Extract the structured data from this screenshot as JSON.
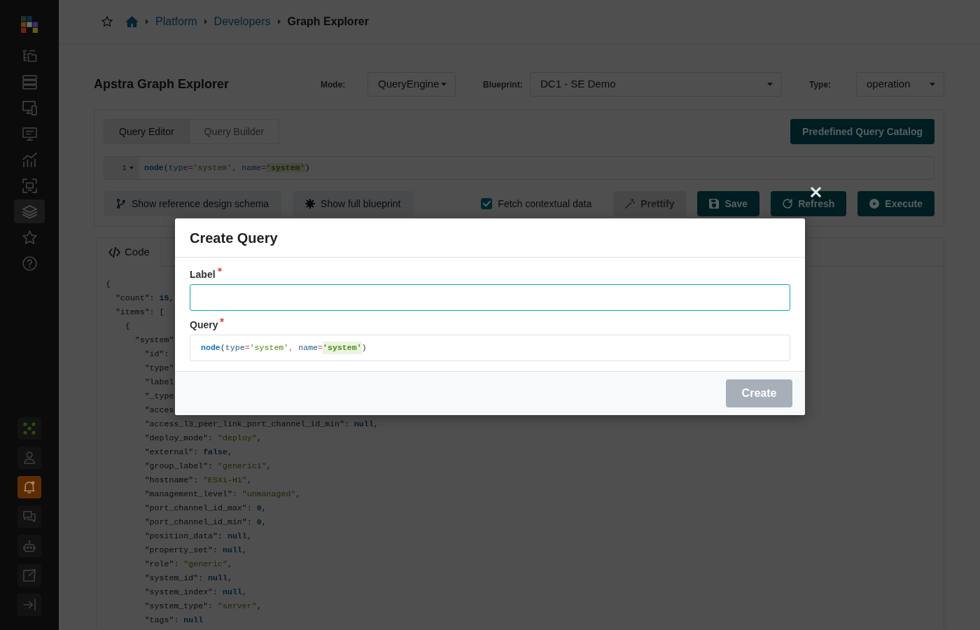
{
  "sidebar": {
    "nav_items": [
      {
        "selected": false
      },
      {
        "selected": false
      },
      {
        "selected": false
      },
      {
        "selected": false
      },
      {
        "selected": false
      },
      {
        "selected": false
      },
      {
        "selected": true
      },
      {
        "selected": false
      },
      {
        "selected": false
      }
    ],
    "utility_items": [
      {
        "alert": false
      },
      {
        "alert": false
      },
      {
        "alert": true
      },
      {
        "alert": false
      },
      {
        "alert": false
      },
      {
        "alert": false
      },
      {
        "alert": false
      }
    ]
  },
  "breadcrumb": [
    {
      "label": "Platform",
      "current": false
    },
    {
      "label": "Developers",
      "current": false
    },
    {
      "label": "Graph Explorer",
      "current": true
    }
  ],
  "page_title": "Apstra Graph Explorer",
  "selectors": [
    {
      "label": "Mode:",
      "value": "QueryEngine"
    },
    {
      "label": "Blueprint:",
      "value": "DC1 - SE Demo"
    },
    {
      "label": "Type:",
      "value": "operation"
    }
  ],
  "editor_tabs": [
    {
      "label": "Query Editor",
      "selected": true
    },
    {
      "label": "Query Builder",
      "selected": false
    }
  ],
  "catalog_button": {
    "label": "Predefined Query Catalog"
  },
  "query_editor": {
    "line_number": "1",
    "tokens": [
      {
        "kind": "function",
        "text": "node",
        "highlighted": false
      },
      {
        "kind": "plain",
        "text": "(",
        "highlighted": false
      },
      {
        "kind": "param",
        "text": "type",
        "highlighted": false
      },
      {
        "kind": "operator",
        "text": "=",
        "highlighted": false
      },
      {
        "kind": "string",
        "text": "'system'",
        "highlighted": false
      },
      {
        "kind": "operator",
        "text": ", ",
        "highlighted": false
      },
      {
        "kind": "param",
        "text": "name",
        "highlighted": false
      },
      {
        "kind": "operator",
        "text": "=",
        "highlighted": false
      },
      {
        "kind": "string",
        "text": "'system'",
        "highlighted": true
      },
      {
        "kind": "plain",
        "text": ")",
        "highlighted": false
      }
    ]
  },
  "toolbar": {
    "left_buttons": [
      {
        "label": "Show reference design schema"
      },
      {
        "label": "Show full blueprint"
      }
    ],
    "fetch_contextual_data": {
      "label": "Fetch contextual data",
      "checked": true
    },
    "right_buttons": [
      {
        "label": "Prettify",
        "disabled": true
      },
      {
        "label": "Save",
        "disabled": false
      },
      {
        "label": "Refresh",
        "disabled": false
      },
      {
        "label": "Execute",
        "disabled": false
      }
    ]
  },
  "result_tabs": [
    {
      "label": "Code",
      "selected": true
    }
  ],
  "code_lines": [
    {
      "tokens": [
        {
          "kind": "plain",
          "text": "{"
        }
      ]
    },
    {
      "tokens": [
        {
          "kind": "plain",
          "text": "  \"count\": "
        },
        {
          "kind": "literal",
          "text": "15"
        },
        {
          "kind": "plain",
          "text": ","
        }
      ]
    },
    {
      "tokens": [
        {
          "kind": "plain",
          "text": "  \"items\": ["
        }
      ]
    },
    {
      "tokens": [
        {
          "kind": "plain",
          "text": "    {"
        }
      ]
    },
    {
      "tokens": [
        {
          "kind": "plain",
          "text": "      \"system\""
        }
      ]
    },
    {
      "tokens": [
        {
          "kind": "plain",
          "text": "        \"id\":"
        }
      ]
    },
    {
      "tokens": [
        {
          "kind": "plain",
          "text": "        \"type\""
        }
      ]
    },
    {
      "tokens": [
        {
          "kind": "plain",
          "text": "        \"label"
        }
      ]
    },
    {
      "tokens": [
        {
          "kind": "plain",
          "text": "        \"_type"
        }
      ]
    },
    {
      "tokens": [
        {
          "kind": "plain",
          "text": "        \"acces"
        }
      ]
    },
    {
      "tokens": [
        {
          "kind": "plain",
          "text": "        \"access_l3_peer_link_port_channel_id_min\": "
        },
        {
          "kind": "literal",
          "text": "null"
        },
        {
          "kind": "plain",
          "text": ","
        }
      ]
    },
    {
      "tokens": [
        {
          "kind": "plain",
          "text": "        \"deploy_mode\": "
        },
        {
          "kind": "string",
          "text": "\"deploy\""
        },
        {
          "kind": "plain",
          "text": ","
        }
      ]
    },
    {
      "tokens": [
        {
          "kind": "plain",
          "text": "        \"external\": "
        },
        {
          "kind": "literal",
          "text": "false"
        },
        {
          "kind": "plain",
          "text": ","
        }
      ]
    },
    {
      "tokens": [
        {
          "kind": "plain",
          "text": "        \"group_label\": "
        },
        {
          "kind": "string",
          "text": "\"generic1\""
        },
        {
          "kind": "plain",
          "text": ","
        }
      ]
    },
    {
      "tokens": [
        {
          "kind": "plain",
          "text": "        \"hostname\": "
        },
        {
          "kind": "string",
          "text": "\"ESXi-H1\""
        },
        {
          "kind": "plain",
          "text": ","
        }
      ]
    },
    {
      "tokens": [
        {
          "kind": "plain",
          "text": "        \"management_level\": "
        },
        {
          "kind": "string",
          "text": "\"unmanaged\""
        },
        {
          "kind": "plain",
          "text": ","
        }
      ]
    },
    {
      "tokens": [
        {
          "kind": "plain",
          "text": "        \"port_channel_id_max\": "
        },
        {
          "kind": "literal",
          "text": "0"
        },
        {
          "kind": "plain",
          "text": ","
        }
      ]
    },
    {
      "tokens": [
        {
          "kind": "plain",
          "text": "        \"port_channel_id_min\": "
        },
        {
          "kind": "literal",
          "text": "0"
        },
        {
          "kind": "plain",
          "text": ","
        }
      ]
    },
    {
      "tokens": [
        {
          "kind": "plain",
          "text": "        \"position_data\": "
        },
        {
          "kind": "literal",
          "text": "null"
        },
        {
          "kind": "plain",
          "text": ","
        }
      ]
    },
    {
      "tokens": [
        {
          "kind": "plain",
          "text": "        \"property_set\": "
        },
        {
          "kind": "literal",
          "text": "null"
        },
        {
          "kind": "plain",
          "text": ","
        }
      ]
    },
    {
      "tokens": [
        {
          "kind": "plain",
          "text": "        \"role\": "
        },
        {
          "kind": "string",
          "text": "\"generic\""
        },
        {
          "kind": "plain",
          "text": ","
        }
      ]
    },
    {
      "tokens": [
        {
          "kind": "plain",
          "text": "        \"system_id\": "
        },
        {
          "kind": "literal",
          "text": "null"
        },
        {
          "kind": "plain",
          "text": ","
        }
      ]
    },
    {
      "tokens": [
        {
          "kind": "plain",
          "text": "        \"system_index\": "
        },
        {
          "kind": "literal",
          "text": "null"
        },
        {
          "kind": "plain",
          "text": ","
        }
      ]
    },
    {
      "tokens": [
        {
          "kind": "plain",
          "text": "        \"system_type\": "
        },
        {
          "kind": "string",
          "text": "\"server\""
        },
        {
          "kind": "plain",
          "text": ","
        }
      ]
    },
    {
      "tokens": [
        {
          "kind": "plain",
          "text": "        \"tags\": "
        },
        {
          "kind": "literal",
          "text": "null"
        }
      ]
    }
  ],
  "modal": {
    "title": "Create Query",
    "fields": [
      {
        "kind": "input",
        "label": "Label",
        "required": true,
        "focused": true
      },
      {
        "kind": "code",
        "label": "Query",
        "required": true,
        "focused": false,
        "tokens": [
          {
            "kind": "function",
            "text": "node",
            "highlighted": false
          },
          {
            "kind": "plain",
            "text": "(",
            "highlighted": false
          },
          {
            "kind": "param",
            "text": "type",
            "highlighted": false
          },
          {
            "kind": "operator",
            "text": "=",
            "highlighted": false
          },
          {
            "kind": "string",
            "text": "'system'",
            "highlighted": false
          },
          {
            "kind": "operator",
            "text": ", ",
            "highlighted": false
          },
          {
            "kind": "param",
            "text": "name",
            "highlighted": false
          },
          {
            "kind": "operator",
            "text": "=",
            "highlighted": false
          },
          {
            "kind": "string",
            "text": "'system'",
            "highlighted": true
          },
          {
            "kind": "plain",
            "text": ")",
            "highlighted": false
          }
        ]
      }
    ],
    "submit": {
      "label": "Create",
      "disabled": true
    }
  }
}
